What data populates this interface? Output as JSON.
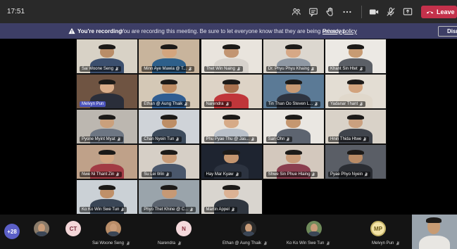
{
  "header": {
    "time": "17:51",
    "leave_label": "Leave",
    "icons": [
      "participants-icon",
      "chat-icon",
      "raise-hand-icon",
      "more-icon",
      "camera-icon",
      "mic-muted-icon",
      "share-icon"
    ]
  },
  "banner": {
    "title": "You're recording",
    "message": "You are recording this meeting. Be sure to let everyone know that they are being recorded.",
    "link": "Privacy policy",
    "dismiss_label": "Dism"
  },
  "grid": {
    "participants": [
      {
        "name": "Sai Woone Seng",
        "bg": "#d8d2c6",
        "skin": "#b98d68",
        "shirt": "#3b4f6e",
        "muted": true
      },
      {
        "name": "Minn Aye Mawia @ T...",
        "bg": "#c8b49c",
        "skin": "#d3a57e",
        "shirt": "#2d5f8a",
        "muted": true
      },
      {
        "name": "Thet Win Naing",
        "bg": "#e9e4dd",
        "skin": "#c29572",
        "shirt": "#d7d2cc",
        "muted": true
      },
      {
        "name": "Dr. Phyu Phyu Khaing",
        "bg": "#dcd7cf",
        "skin": "#d6a886",
        "shirt": "#8f98a3",
        "muted": true
      },
      {
        "name": "Khant Sin Htet",
        "bg": "#ece9e4",
        "skin": "#c79b73",
        "shirt": "#5b5f66",
        "muted": true
      },
      {
        "name": "Melvyn Pun",
        "bg": "#6f5442",
        "skin": "#d9ad8a",
        "shirt": "#2a2e3a",
        "muted": false,
        "active": true
      },
      {
        "name": "Ethan @ Aung Thaik",
        "bg": "#d4c8b6",
        "skin": "#bd8c64",
        "shirt": "#2f5d92",
        "muted": true
      },
      {
        "name": "Narendra",
        "bg": "#ddd3c6",
        "skin": "#a8714e",
        "shirt": "#c0363a",
        "muted": true
      },
      {
        "name": "Tin Than Oo Steven L...",
        "bg": "#5b7a96",
        "skin": "#c89a74",
        "shirt": "#2e3440",
        "muted": true
      },
      {
        "name": "Yadanar Thant",
        "bg": "#e3ddd3",
        "skin": "#d2a37d",
        "shirt": "#e0d8cb",
        "muted": true
      },
      {
        "name": "Pyone Myint Myat",
        "bg": "#bcb7b0",
        "skin": "#caa07c",
        "shirt": "#6d7683",
        "muted": true
      },
      {
        "name": "Chan Nyein Tun",
        "bg": "#cfd3d8",
        "skin": "#bd8e66",
        "shirt": "#3d4b5c",
        "muted": true
      },
      {
        "name": "Phu Pyae Thu @ Jas...",
        "bg": "#e8e3dc",
        "skin": "#d6aa87",
        "shirt": "#b9c0c9",
        "muted": true
      },
      {
        "name": "Sari Ohn",
        "bg": "#eae7e2",
        "skin": "#c59770",
        "shirt": "#5d6470",
        "muted": true
      },
      {
        "name": "Hnin Thida Htwe",
        "bg": "#d9d2c8",
        "skin": "#caa07f",
        "shirt": "#40444c",
        "muted": true
      },
      {
        "name": "Nwe Ni Thant Zin",
        "bg": "#bfa189",
        "skin": "#d3a784",
        "shirt": "#a23b44",
        "muted": true
      },
      {
        "name": "Su Lei Win",
        "bg": "#d6cfc6",
        "skin": "#c99c78",
        "shirt": "#4a576b",
        "muted": true
      },
      {
        "name": "Hay Mar Kyaw",
        "bg": "#1e2430",
        "skin": "#c49670",
        "shirt": "#2c3340",
        "muted": true
      },
      {
        "name": "Shwe Sin Phue Hlaing",
        "bg": "#d3c8bd",
        "skin": "#c89b78",
        "shirt": "#8a3e4f",
        "muted": true
      },
      {
        "name": "Pyae Phyo Nyein",
        "bg": "#5a5e66",
        "skin": "#b88b66",
        "shirt": "#2a2d33",
        "muted": true
      },
      {
        "name": "Ko Ko Win Swe Tun",
        "bg": "#cbd1d6",
        "skin": "#bf9069",
        "shirt": "#3a4656",
        "muted": true
      },
      {
        "name": "Phyo Thet Khine @ C...",
        "bg": "#9aa4ab",
        "skin": "#c69975",
        "shirt": "#5a626d",
        "muted": true
      },
      {
        "name": "Martin Appel",
        "bg": "#d9d5cf",
        "skin": "#dcb294",
        "shirt": "#30363f",
        "muted": true
      }
    ]
  },
  "strip": {
    "overflow_count": "+28",
    "items": [
      {
        "kind": "photo",
        "name": "",
        "color": "#8a7b6a"
      },
      {
        "kind": "initials",
        "initials": "CT",
        "name": "",
        "color": "#f3d6d8",
        "text_color": "#7a2a3a"
      },
      {
        "kind": "photo",
        "name": "Sai Woone Seng",
        "color": "#b98d68"
      },
      {
        "kind": "initials",
        "initials": "N",
        "name": "Narendra",
        "color": "#f4d9dc",
        "text_color": "#8a2f3d"
      },
      {
        "kind": "photo",
        "name": "Ethan @ Aung Thaik",
        "color": "#2b2b2b"
      },
      {
        "kind": "photo",
        "name": "Ko Ko Win Swe Tun",
        "color": "#6f8a5a"
      },
      {
        "kind": "initials",
        "initials": "MP",
        "name": "Melvyn Pun",
        "color": "#f3e3a6",
        "text_color": "#6b5a1a"
      }
    ]
  },
  "colors": {
    "leave": "#c4314b",
    "banner": "#3d3e66",
    "active_speaker": "#4b53bc"
  }
}
